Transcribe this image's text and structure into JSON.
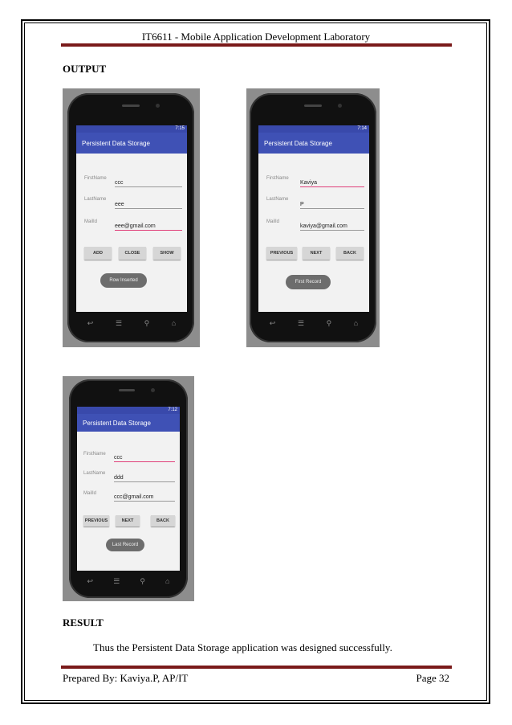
{
  "header": "IT6611 - Mobile Application Development Laboratory",
  "output_heading": "OUTPUT",
  "result_heading": "RESULT",
  "result_text": "Thus the Persistent Data Storage application was designed successfully.",
  "footer": {
    "left": "Prepared By: Kaviya.P, AP/IT",
    "right": "Page 32"
  },
  "app_title": "Persistent Data Storage",
  "labels": {
    "first": "FirstName",
    "last": "LastName",
    "mail": "MailId"
  },
  "screens": [
    {
      "time": "7:15",
      "first": "ccc",
      "last": "eee",
      "mail": "eee@gmail.com",
      "buttons": [
        "ADD",
        "CLOSE",
        "SHOW"
      ],
      "toast": "Row Inserted"
    },
    {
      "time": "7:14",
      "first": "Kaviya",
      "last": "P",
      "mail": "kaviya@gmail.com",
      "buttons": [
        "PREVIOUS",
        "NEXT",
        "BACK"
      ],
      "toast": "First Record"
    },
    {
      "time": "7:12",
      "first": "ccc",
      "last": "ddd",
      "mail": "ccc@gmail.com",
      "buttons": [
        "PREVIOUS",
        "NEXT",
        "BACK"
      ],
      "toast": "Last Record"
    }
  ],
  "nav_icons": [
    "back-icon",
    "recent-apps-icon",
    "search-icon",
    "home-icon"
  ]
}
